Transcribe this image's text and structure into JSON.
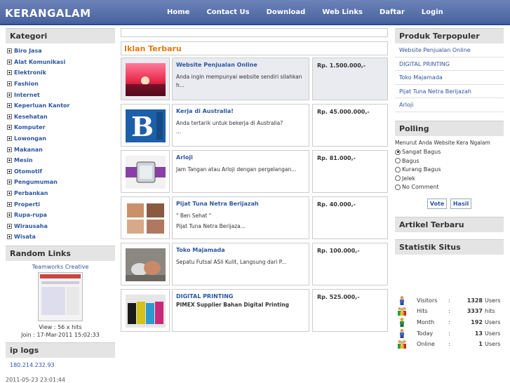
{
  "header": {
    "logo": "KERANGALAM",
    "nav": [
      "Home",
      "Contact Us",
      "Download",
      "Web Links",
      "Daftar",
      "Login"
    ]
  },
  "kategori": {
    "title": "Kategori",
    "items": [
      "Biro Jasa",
      "Alat Komunikasi",
      "Elektronik",
      "Fashion",
      "Internet",
      "Keperluan Kantor",
      "Kesehatan",
      "Komputer",
      "Lowongan",
      "Makanan",
      "Mesin",
      "Otomotif",
      "Pengumuman",
      "Perbankan",
      "Properti",
      "Rupa-rupa",
      "Wirausaha",
      "Wisata"
    ]
  },
  "random_links": {
    "title": "Random Links",
    "name": "Teamworks Creative",
    "view": "View : 56 x hits",
    "join": "Join : 17-Mar-2011 15:02:33"
  },
  "iplogs": {
    "title": "ip logs",
    "ip": "180.214.232.93",
    "date": "2011-05-23 23:01:44"
  },
  "main": {
    "title": "Iklan Terbaru",
    "ads": [
      {
        "title": "Website Penjualan Online",
        "desc1": "Anda ingin mempunyai website sendiri silahkan",
        "desc2": "h...",
        "price": "Rp. 1.500.000,-",
        "image": "sunset-image"
      },
      {
        "title": "Kerja di Australia!",
        "desc1": "Anda tertarik untuk bekerja di Australia?",
        "desc2": "...",
        "price": "Rp. 45.000.000,-",
        "image": "logo-image"
      },
      {
        "title": "Arloji",
        "desc1": "Jam Tangan atau Arloji dengan  pergelangan...",
        "desc2": "",
        "price": "Rp. 81.000,-",
        "image": "watch-image"
      },
      {
        "title": "Pijat Tuna Netra Berijazah",
        "desc1": "\" Ben Sehat \"",
        "desc2": "Pijat Tuna Netra Berijaza...",
        "price": "Rp. 40.000,-",
        "image": "massage-image"
      },
      {
        "title": "Toko Majamada",
        "desc1": "Sepatu Futsal ASli Kulit,  Langsung dari P...",
        "desc2": "",
        "price": "Rp. 100.000,-",
        "image": "shoes-image"
      },
      {
        "title": "DIGITAL PRINTING",
        "desc1": "PIMEX Supplier Bahan Digital Printing",
        "desc2": "",
        "price": "Rp. 525.000,-",
        "image": "ink-image"
      }
    ]
  },
  "populer": {
    "title": "Produk Terpopuler",
    "items": [
      "Website Penjualan Online",
      "DIGITAL PRINTING",
      "Toko Majamada",
      "Pijat Tuna Netra Berijazah",
      "Arloji"
    ]
  },
  "polling": {
    "title": "Polling",
    "question": "Menurut Anda Website Kera Ngalam",
    "options": [
      "Sangat Bagus",
      "Bagus",
      "Kurang Bagus",
      "Jelek",
      "No Comment"
    ],
    "selected": "Sangat Bagus",
    "vote": "Vote",
    "hasil": "Hasil"
  },
  "artikel": {
    "title": "Artikel Terbaru"
  },
  "statistik": {
    "title": "Statistik Situs",
    "rows": [
      {
        "label": "Visitors",
        "value": "1328",
        "unit": "Users",
        "icon": "single-user-icon"
      },
      {
        "label": "Hits",
        "value": "3337",
        "unit": "hits",
        "icon": "group-users-icon"
      },
      {
        "label": "Month",
        "value": "192",
        "unit": "Users",
        "icon": "single-user-icon"
      },
      {
        "label": "Today",
        "value": "13",
        "unit": "Users",
        "icon": "single-user-icon"
      },
      {
        "label": "Online",
        "value": "1",
        "unit": "Users",
        "icon": "group-users-icon"
      }
    ]
  },
  "colors": {
    "header": "#46619d",
    "link": "#2d56a0",
    "accent": "#e67a10"
  }
}
